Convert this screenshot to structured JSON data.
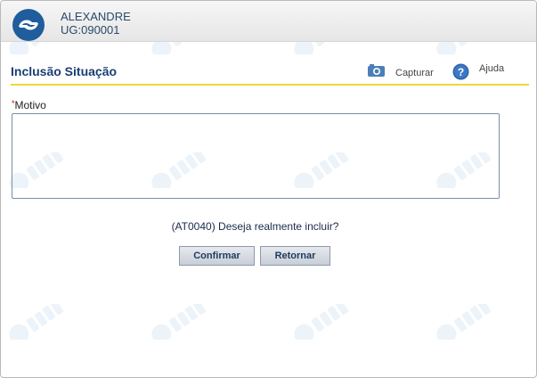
{
  "header": {
    "user_name": "ALEXANDRE",
    "user_ug": "UG:090001",
    "logo_icon": "siafi-logo-icon"
  },
  "title_bar": {
    "title": "Inclusão Situação",
    "capture_label": "Capturar",
    "help_label": "Ajuda"
  },
  "form": {
    "required_mark": "*",
    "motivo_label": "Motivo",
    "motivo_value": ""
  },
  "message": "(AT0040) Deseja realmente incluir?",
  "buttons": {
    "confirm_label": "Confirmar",
    "return_label": "Retornar"
  },
  "colors": {
    "title": "#1a3f73",
    "accent_line": "#efd63c",
    "required": "#cc0000",
    "logo_blue": "#1f5d9c"
  }
}
